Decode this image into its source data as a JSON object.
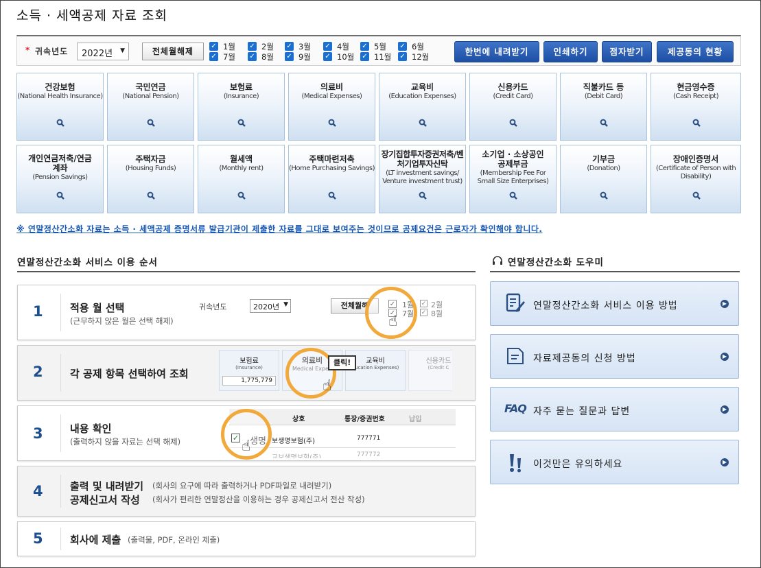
{
  "page": {
    "title": "소득 · 세액공제 자료 조회"
  },
  "toolbar": {
    "required_mark": "*",
    "year_label": "귀속년도",
    "year_value": "2022년",
    "deselect_label": "전체월해제",
    "months": [
      "1월",
      "2월",
      "3월",
      "4월",
      "5월",
      "6월",
      "7월",
      "8월",
      "9월",
      "10월",
      "11월",
      "12월"
    ],
    "buttons": {
      "download_all": "한번에 내려받기",
      "print": "인쇄하기",
      "braille": "점자받기",
      "provider_status": "제공동의 현황"
    }
  },
  "categories": [
    {
      "ko": "건강보험",
      "en": "(National Health Insurance)"
    },
    {
      "ko": "국민연금",
      "en": "(National Pension)"
    },
    {
      "ko": "보험료",
      "en": "(Insurance)"
    },
    {
      "ko": "의료비",
      "en": "(Medical Expenses)"
    },
    {
      "ko": "교육비",
      "en": "(Education Expenses)"
    },
    {
      "ko": "신용카드",
      "en": "(Credit Card)"
    },
    {
      "ko": "직불카드 등",
      "en": "(Debit Card)"
    },
    {
      "ko": "현금영수증",
      "en": "(Cash Receipt)"
    },
    {
      "ko": "개인연금저축/연금계좌",
      "en": "(Pension Savings)"
    },
    {
      "ko": "주택자금",
      "en": "(Housing Funds)"
    },
    {
      "ko": "월세액",
      "en": "(Monthly rent)"
    },
    {
      "ko": "주택마련저축",
      "en": "(Home Purchasing Savings)"
    },
    {
      "ko": "장기집합투자증권저축/벤처기업투자신탁",
      "en": "(LT investment savings/ Venture investment trust)"
    },
    {
      "ko": "소기업 · 소상공인 공제부금",
      "en": "(Membership Fee For Small Size Enterprises)"
    },
    {
      "ko": "기부금",
      "en": "(Donation)"
    },
    {
      "ko": "장애인증명서",
      "en": "(Certificate of Person with Disability)"
    }
  ],
  "notice": "※ 연말정산간소화 자료는 소득 · 세액공제 증명서류 발급기관이 제출한 자료를 그대로 보여주는 것이므로 공제요건은 근로자가 확인해야 합니다.",
  "steps_section": {
    "title": "연말정산간소화 서비스 이용 순서"
  },
  "steps": [
    {
      "num": "1",
      "title": "적용 월 선택",
      "sub": "(근무하지 않은 월은 선택 해제)"
    },
    {
      "num": "2",
      "title": "각 공제 항목 선택하여 조회",
      "sub": ""
    },
    {
      "num": "3",
      "title": "내용 확인",
      "sub": "(출력하지 않을 자료는 선택 해제)"
    },
    {
      "num": "4",
      "title": "출력 및 내려받기",
      "title2": "공제신고서 작성",
      "sub": "(회사의 요구에 따라 출력하거나 PDF파일로 내려받기)",
      "sub2": "(회사가 편리한 연말정산을 이용하는 경우 공제신고서 전산 작성)"
    },
    {
      "num": "5",
      "title": "회사에 제출",
      "sub": "(출력물, PDF, 온라인 제출)"
    }
  ],
  "illustrations": {
    "s1": {
      "year_label": "귀속년도",
      "year": "2020년",
      "button": "전체월해",
      "m1": "1월",
      "m7": "7월",
      "m2": "2월",
      "m8": "8월"
    },
    "s2": {
      "t1_ko": "보험료",
      "t1_en": "(Insurance)",
      "t1_val": "1,775,779",
      "t2_ko": "의료비",
      "t2_en": "Medical Expen",
      "t3_ko": "교육비",
      "t3_en": "ducation Expenses)",
      "t4_ko": "신용카드",
      "t4_en": "(Credit C",
      "click": "클릭!"
    },
    "s3": {
      "h1": "상호",
      "h2": "통장/증권번호",
      "h3": "납입",
      "r1a": "생명",
      "r1b": "보생명보험(주)",
      "r1c": "777771",
      "r2b": "교보생명보험(주)",
      "r2c": "777772"
    }
  },
  "help_section": {
    "title": "연말정산간소화 도우미"
  },
  "help_items": [
    {
      "label": "연말정산간소화 서비스 이용 방법"
    },
    {
      "label": "자료제공동의 신청 방법"
    },
    {
      "label": "자주 묻는 질문과 답변",
      "badge": "FAQ"
    },
    {
      "label": "이것만은 유의하세요"
    }
  ],
  "colors": {
    "accent": "#1d4fa4",
    "tile_border": "#a9c3dc",
    "highlight_ring": "#f2a93b",
    "step_number": "#1d4f8f"
  }
}
